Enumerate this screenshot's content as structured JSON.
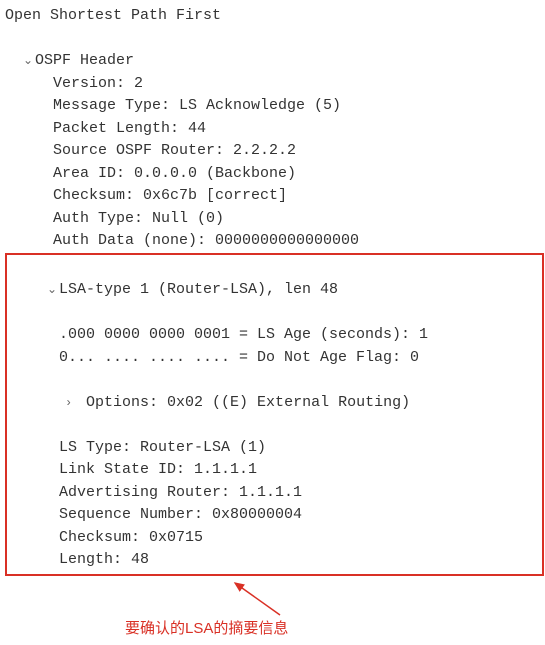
{
  "title": "Open Shortest Path First",
  "header": {
    "label": "OSPF Header",
    "fields": {
      "version": "Version: 2",
      "msgtype": "Message Type: LS Acknowledge (5)",
      "pktlen": "Packet Length: 44",
      "srcrouter": "Source OSPF Router: 2.2.2.2",
      "areaid": "Area ID: 0.0.0.0 (Backbone)",
      "checksum": "Checksum: 0x6c7b [correct]",
      "authtype": "Auth Type: Null (0)",
      "authdata": "Auth Data (none): 0000000000000000"
    }
  },
  "lsa": {
    "label": "LSA-type 1 (Router-LSA), len 48",
    "fields": {
      "lsage": ".000 0000 0000 0001 = LS Age (seconds): 1",
      "donotage": "0... .... .... .... = Do Not Age Flag: 0",
      "options": "Options: 0x02 ((E) External Routing)",
      "lstype": "LS Type: Router-LSA (1)",
      "linkstateid": "Link State ID: 1.1.1.1",
      "advrouter": "Advertising Router: 1.1.1.1",
      "seqnum": "Sequence Number: 0x80000004",
      "checksum": "Checksum: 0x0715",
      "length": "Length: 48"
    }
  },
  "annotation": "要确认的LSA的摘要信息",
  "carets": {
    "open": "⌄",
    "closed": "›"
  }
}
